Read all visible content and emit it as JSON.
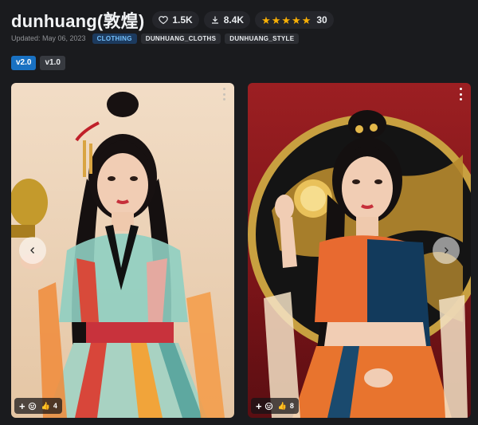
{
  "model": {
    "title": "dunhuang(敦煌)",
    "stats": {
      "likes": "1.5K",
      "downloads": "8.4K",
      "rating_count": "30"
    },
    "updated": "Updated: May 06, 2023",
    "tags": [
      "CLOTHING",
      "DUNHUANG_CLOTHS",
      "DUNHUANG_STYLE"
    ]
  },
  "versions": [
    "v2.0",
    "v1.0"
  ],
  "gallery": [
    {
      "reaction_count": "4"
    },
    {
      "reaction_count": "8"
    }
  ],
  "colors": {
    "accent": "#1971c2",
    "star": "#fab005",
    "background": "#1a1b1e"
  }
}
